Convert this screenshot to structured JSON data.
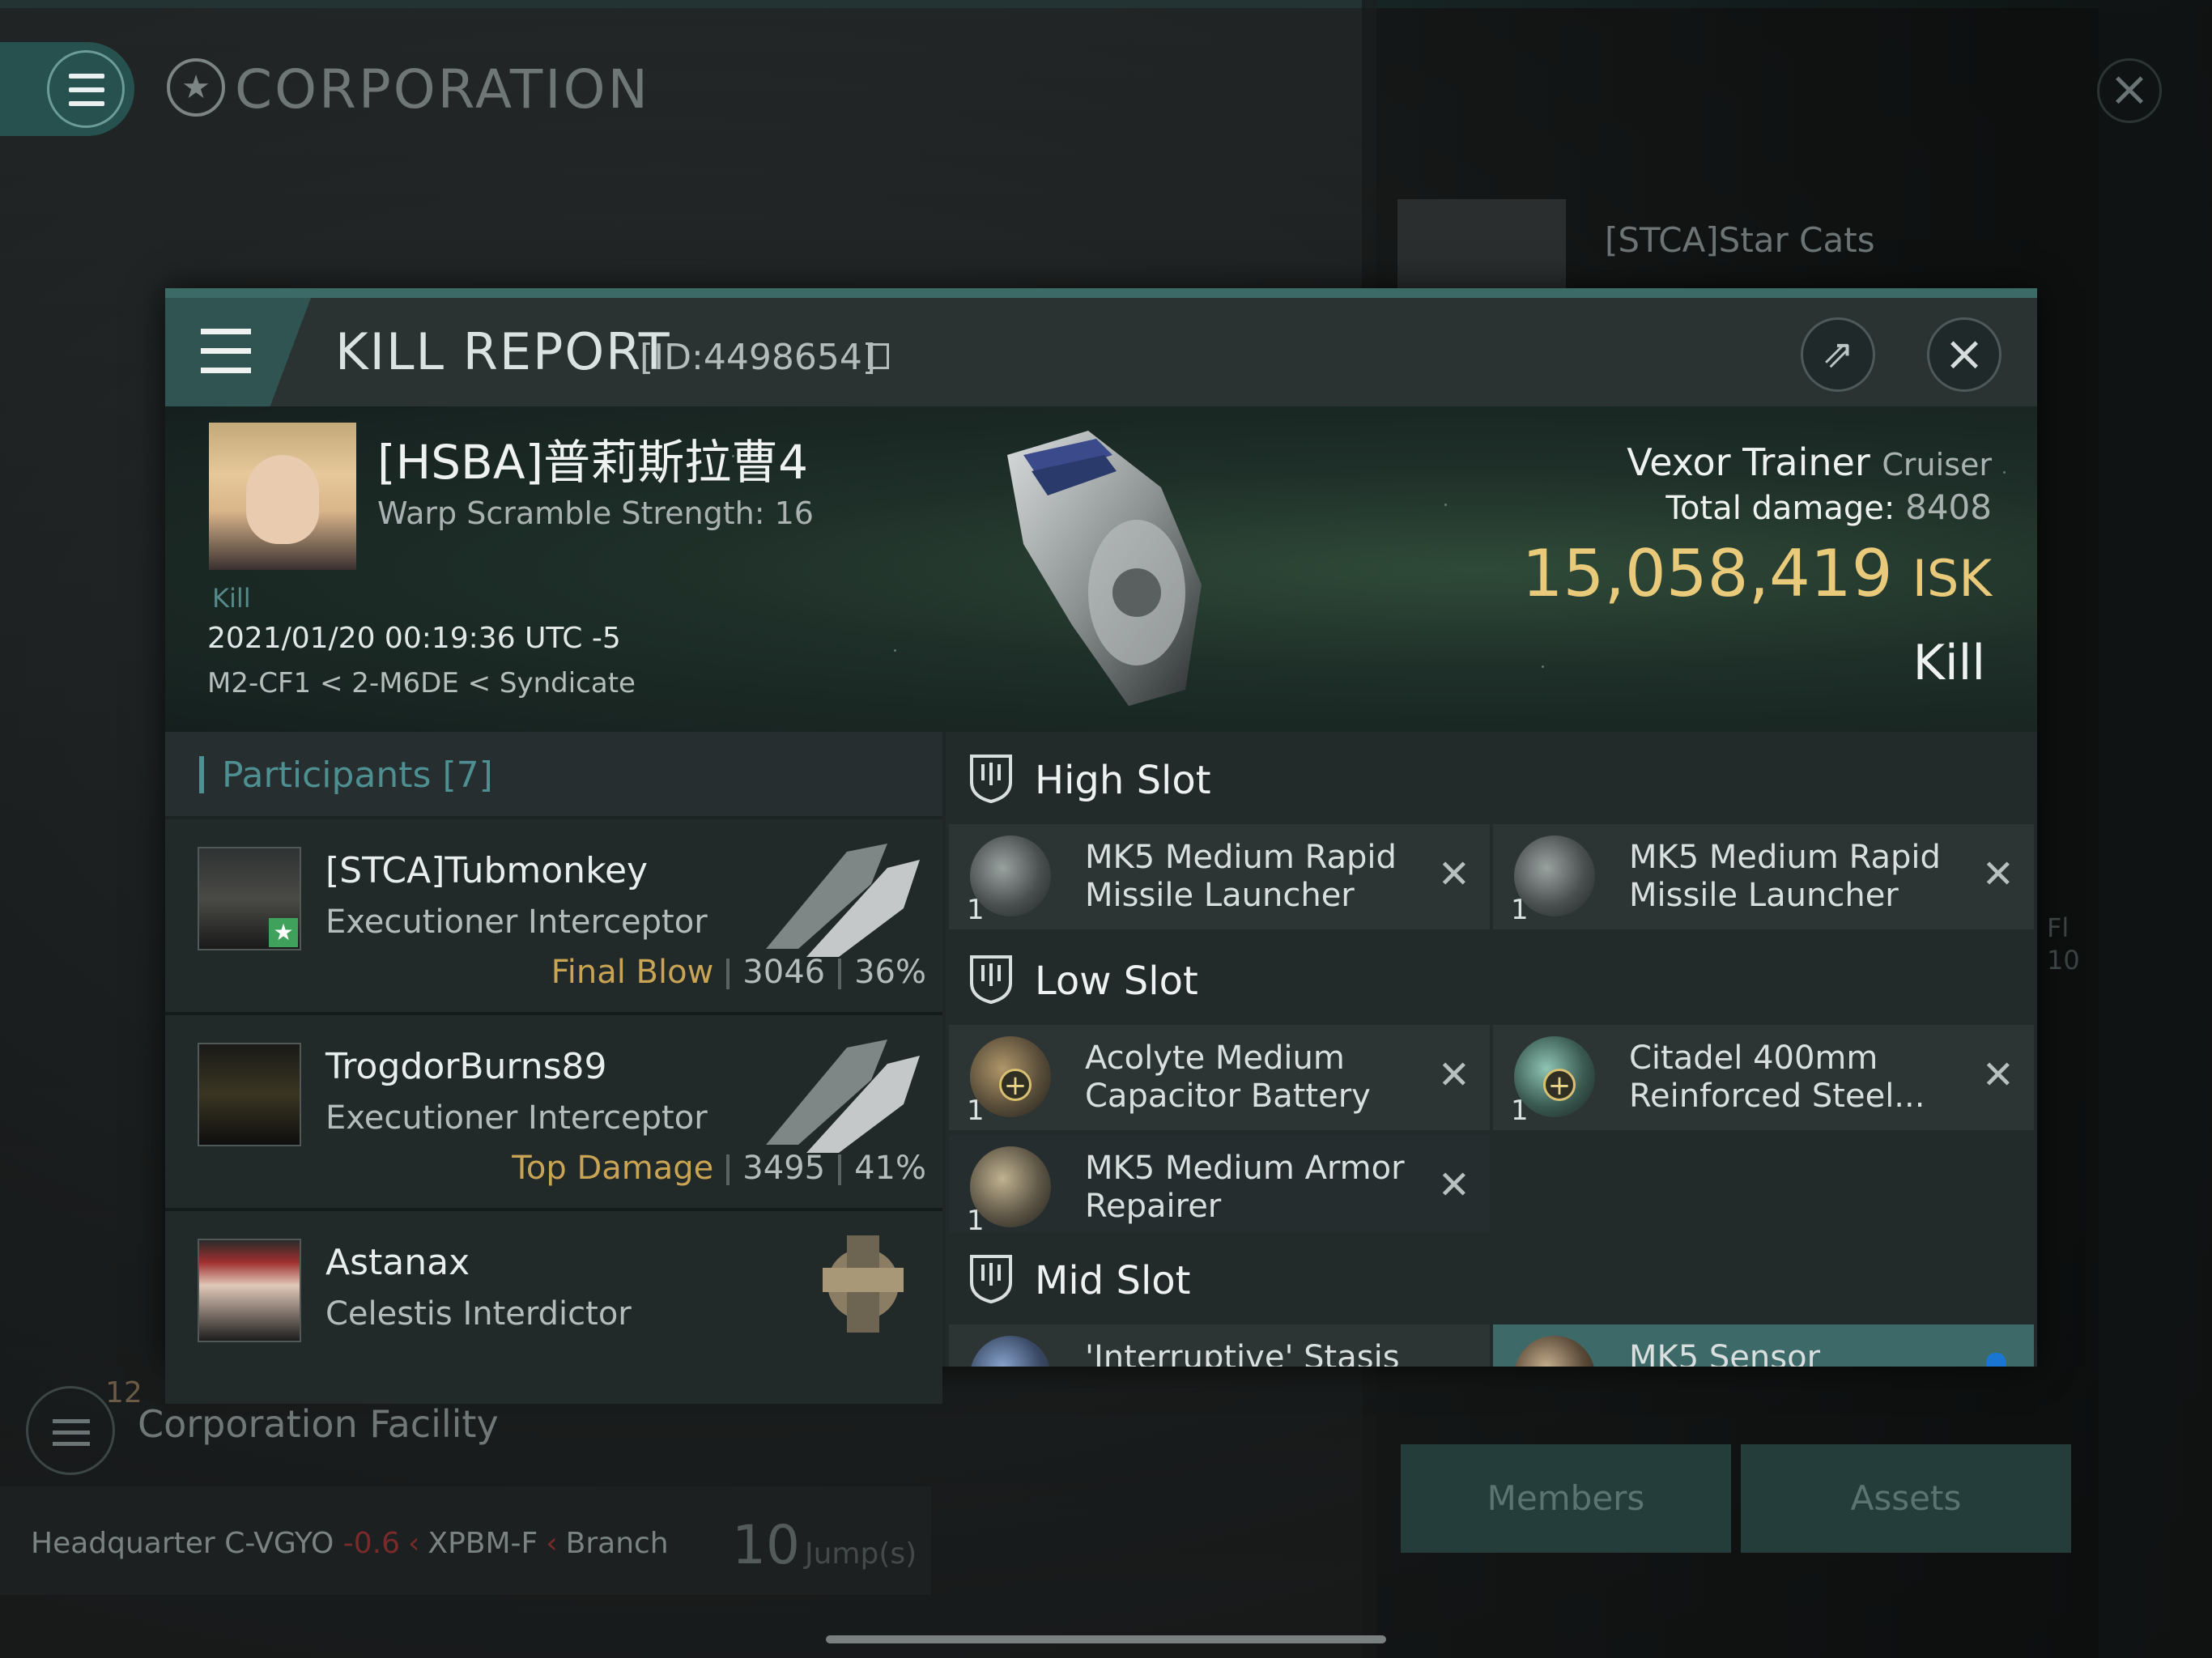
{
  "app": {
    "section_title": "CORPORATION",
    "corp_name": "[STCA]Star Cats"
  },
  "kill_report": {
    "title": "KILL REPORT",
    "id_label": "[ID:4498654]",
    "victim": {
      "name": "[HSBA]普莉斯拉曹4",
      "warp_scramble": "Warp Scramble Strength: 16",
      "tag": "Kill",
      "datetime": "2021/01/20 00:19:36 UTC -5",
      "location": "M2-CF1 < 2-M6DE < Syndicate"
    },
    "ship": {
      "name": "Vexor Trainer",
      "class": "Cruiser",
      "total_damage_label": "Total damage:",
      "total_damage": "8408",
      "isk_value": "15,058,419",
      "isk_unit": "ISK",
      "result": "Kill"
    },
    "participants": {
      "header": "Participants [7]",
      "items": [
        {
          "name": "[STCA]Tubmonkey",
          "ship": "Executioner Interceptor",
          "tag": "Final Blow",
          "damage": "3046",
          "percent": "36%"
        },
        {
          "name": "TrogdorBurns89",
          "ship": "Executioner Interceptor",
          "tag": "Top Damage",
          "damage": "3495",
          "percent": "41%"
        },
        {
          "name": "Astanax",
          "ship": "Celestis Interdictor",
          "tag": "",
          "damage": "",
          "percent": ""
        }
      ]
    },
    "fitting": {
      "high_slot_label": "High Slot",
      "low_slot_label": "Low Slot",
      "mid_slot_label": "Mid Slot",
      "high": [
        {
          "qty": "1",
          "name": "MK5 Medium Rapid Missile Launcher"
        },
        {
          "qty": "1",
          "name": "MK5 Medium Rapid Missile Launcher"
        }
      ],
      "low": [
        {
          "qty": "1",
          "name": "Acolyte Medium Capacitor Battery"
        },
        {
          "qty": "1",
          "name": "Citadel 400mm Reinforced Steel..."
        },
        {
          "qty": "1",
          "name": "MK5 Medium Armor Repairer"
        }
      ],
      "mid": [
        {
          "qty": "",
          "name": "'Interruptive' Stasis"
        },
        {
          "qty": "",
          "name": "MK5 Sensor"
        }
      ]
    }
  },
  "background": {
    "facility_count": "12",
    "facility_title": "Corporation Facility",
    "hq_label": "Headquarter",
    "hq_system": "C-VGYO",
    "hq_security": "-0.6",
    "hq_region": "XPBM-F",
    "hq_type": "Branch",
    "jumps_value": "10",
    "jumps_unit": "Jump(s)",
    "members_button": "Members",
    "assets_button": "Assets",
    "side_fragment_1": "Fl",
    "side_fragment_2": "10"
  },
  "colors": {
    "accent_teal": "#3c6a66",
    "isk_gold": "#e9c97a",
    "participants_teal": "#4e8f92",
    "tag_gold": "#c9a454"
  }
}
